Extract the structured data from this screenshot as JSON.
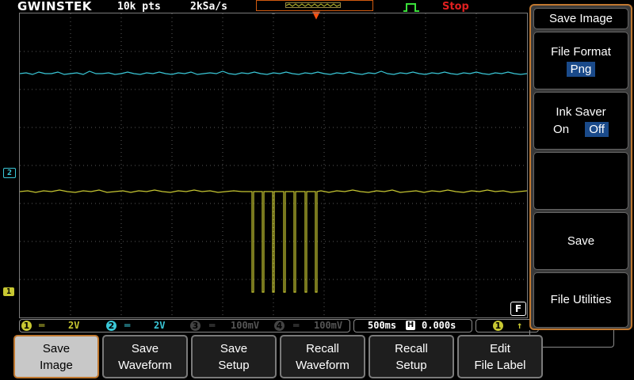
{
  "brand": "GWINSTEK",
  "acquisition": {
    "record_length": "10k pts",
    "sample_rate": "2kSa/s"
  },
  "run_state": "Stop",
  "channels": [
    {
      "num": "1",
      "coupling_icon": "dc-coupling-icon",
      "scale": "2V",
      "color": "#c8c832",
      "enabled": true
    },
    {
      "num": "2",
      "coupling_icon": "dc-coupling-icon",
      "scale": "2V",
      "color": "#3ac8d8",
      "enabled": true
    },
    {
      "num": "3",
      "coupling_icon": "dc-coupling-icon",
      "scale": "100mV",
      "color": "#555555",
      "enabled": false
    },
    {
      "num": "4",
      "coupling_icon": "dc-coupling-icon",
      "scale": "100mV",
      "color": "#555555",
      "enabled": false
    }
  ],
  "timebase": {
    "scale": "500ms",
    "h_label": "H",
    "position": "0.000s"
  },
  "trigger": {
    "source": "1",
    "slope_icon": "rising-edge-icon"
  },
  "markers": {
    "ch1": "1",
    "ch2": "2",
    "trigger_pos": "▼"
  },
  "memory_badge": "F",
  "side_menu": {
    "title": "Save Image",
    "file_format": {
      "label": "File Format",
      "value": "Png"
    },
    "ink_saver": {
      "label": "Ink Saver",
      "on": "On",
      "off": "Off",
      "selected": "Off"
    },
    "blank": "",
    "save": "Save",
    "file_utilities": "File Utilities"
  },
  "bottom_menu": [
    {
      "line1": "Save",
      "line2": "Image",
      "active": true
    },
    {
      "line1": "Save",
      "line2": "Waveform",
      "active": false
    },
    {
      "line1": "Save",
      "line2": "Setup",
      "active": false
    },
    {
      "line1": "Recall",
      "line2": "Waveform",
      "active": false
    },
    {
      "line1": "Recall",
      "line2": "Setup",
      "active": false
    },
    {
      "line1": "Edit",
      "line2": "File Label",
      "active": false
    }
  ],
  "colors": {
    "ch1": "#c8c832",
    "ch2": "#3ac8d8",
    "accent": "#c07830",
    "stop": "#e02020",
    "trigger": "#ff5010"
  }
}
